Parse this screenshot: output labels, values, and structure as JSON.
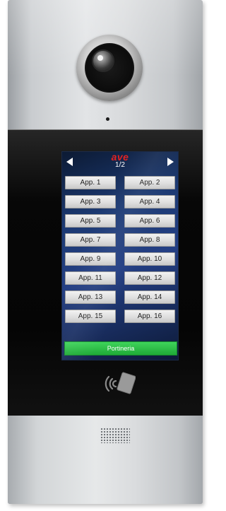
{
  "device": {
    "brand": "ave",
    "page_indicator": "1/2",
    "apartments": [
      "App. 1",
      "App. 2",
      "App. 3",
      "App. 4",
      "App. 5",
      "App. 6",
      "App. 7",
      "App. 8",
      "App. 9",
      "App. 10",
      "App. 11",
      "App. 12",
      "App. 13",
      "App. 14",
      "App. 15",
      "App. 16"
    ],
    "portineria_label": "Portineria",
    "colors": {
      "brand": "#e32222",
      "screen": "#1c3a73",
      "portineria": "#2fbf47",
      "button": "#e4e4e4"
    },
    "icons": [
      "camera-icon",
      "nfc-reader-icon",
      "speaker-grille-icon",
      "arrow-left-icon",
      "arrow-right-icon"
    ]
  }
}
